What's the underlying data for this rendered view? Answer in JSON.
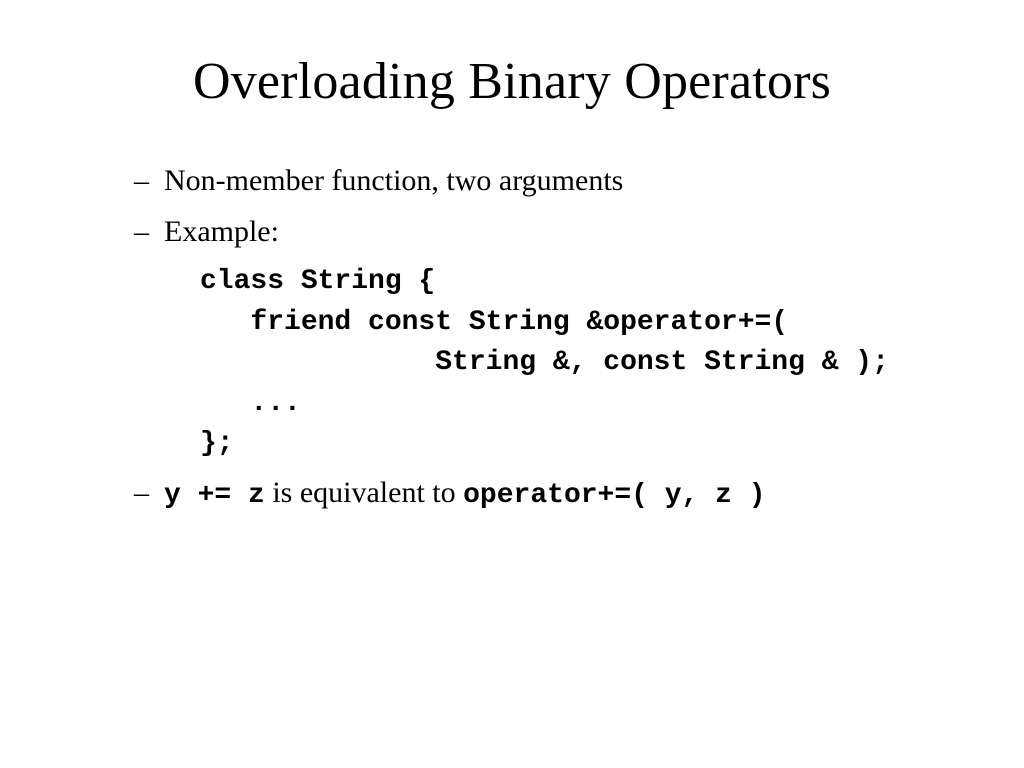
{
  "title": "Overloading Binary Operators",
  "bullets": {
    "b1": "Non-member function, two arguments",
    "b2": "Example:",
    "b3_code1": "y += z",
    "b3_mid": " is equivalent to ",
    "b3_code2": "operator+=( y, z )"
  },
  "code": {
    "l1": "class String {",
    "l2": "   friend const String &operator+=(",
    "l3": "              String &, const String & );",
    "l4": "   ...",
    "l5": "};"
  },
  "dash": "–"
}
